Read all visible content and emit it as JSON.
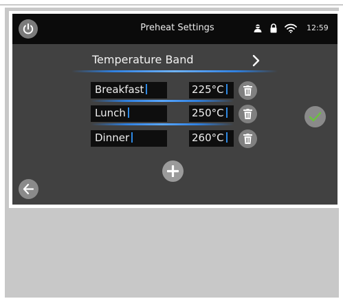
{
  "header": {
    "title": "Preheat Settings",
    "time": "12:59",
    "icons": [
      "power-icon",
      "user-icon",
      "lock-icon",
      "wifi-icon"
    ]
  },
  "band": {
    "label": "Temperature Band"
  },
  "entries": [
    {
      "name": "Breakfast",
      "temp": "225°C"
    },
    {
      "name": "Lunch",
      "temp": "250°C"
    },
    {
      "name": "Dinner",
      "temp": "260°C"
    }
  ],
  "actions": {
    "confirm_icon": "checkmark-icon",
    "add_icon": "plus-icon",
    "back_icon": "arrow-left-icon",
    "delete_icon": "trash-icon"
  },
  "colors": {
    "screen_bg": "#414141",
    "statusbar_bg": "#0b0b0b",
    "accent_blue": "#2f80e0",
    "confirm_green": "#6ac43b"
  }
}
